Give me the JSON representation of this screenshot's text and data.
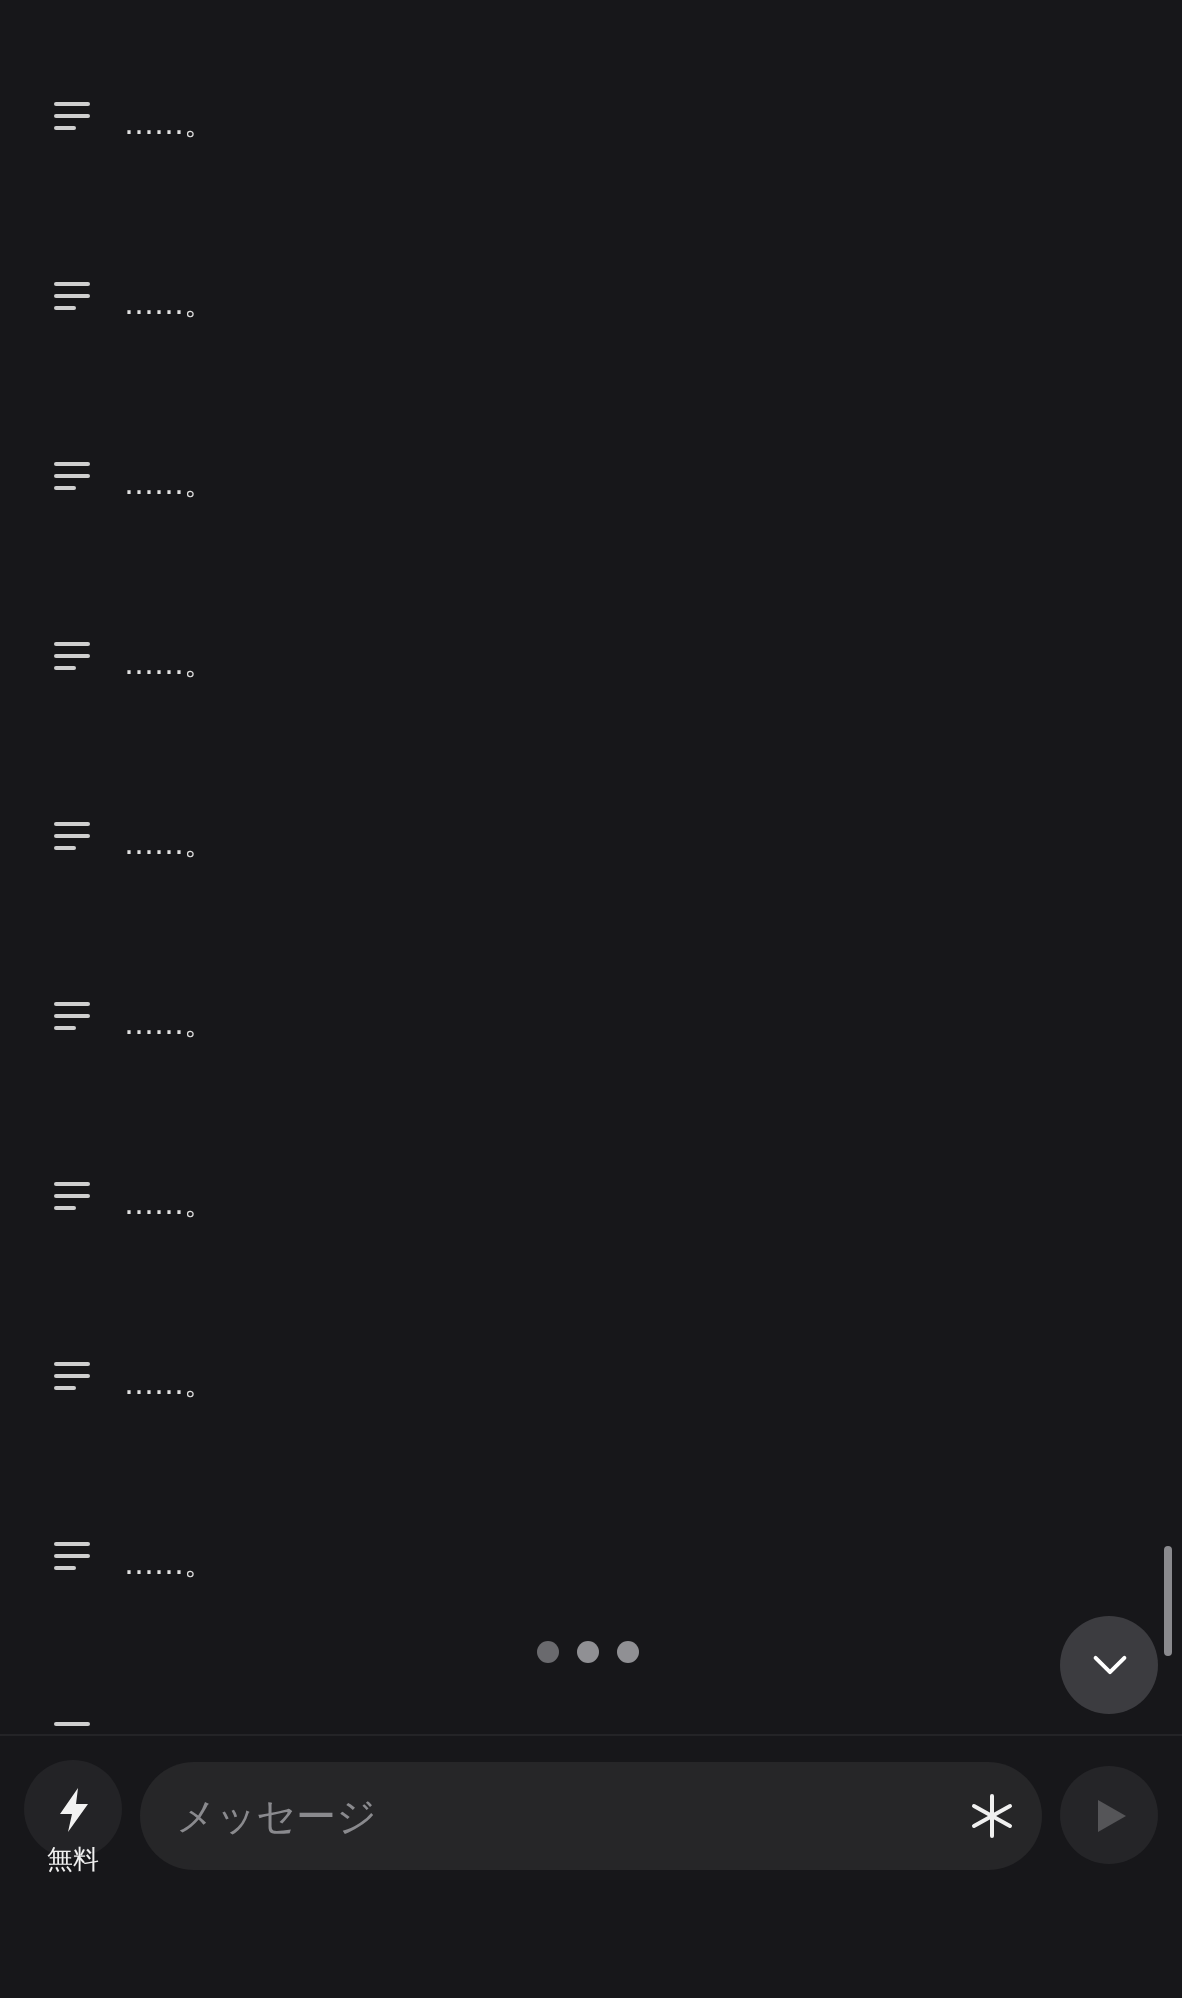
{
  "messages": [
    {
      "text": "……。"
    },
    {
      "text": "……。"
    },
    {
      "text": "……。"
    },
    {
      "text": "……。"
    },
    {
      "text": "……。"
    },
    {
      "text": "……。"
    },
    {
      "text": "……。"
    },
    {
      "text": "……。"
    },
    {
      "text": "……。"
    }
  ],
  "composer": {
    "mode_label": "無料",
    "placeholder": "メッセージ"
  }
}
